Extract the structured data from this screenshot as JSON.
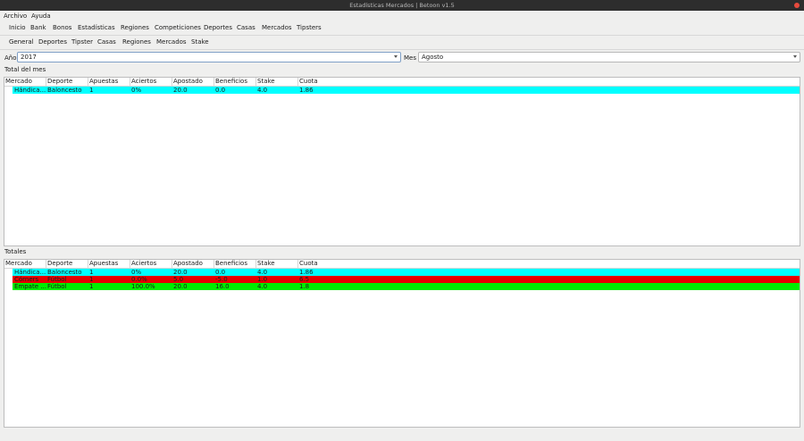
{
  "window": {
    "title": "Estadísticas Mercados | Betoon v1.5"
  },
  "menubar": {
    "items": [
      "Archivo",
      "Ayuda"
    ]
  },
  "main_toolbar": {
    "items": [
      "Inicio",
      "Bank",
      "Bonos",
      "Estadísticas",
      "Regiones",
      "Competiciones",
      "Deportes",
      "Casas",
      "Mercados",
      "Tipsters"
    ]
  },
  "sub_toolbar": {
    "items": [
      "General",
      "Deportes",
      "Tipster",
      "Casas",
      "Regiones",
      "Mercados",
      "Stake"
    ]
  },
  "filters": {
    "year_label": "Año",
    "year_value": "2017",
    "month_label": "Mes",
    "month_value": "Agosto"
  },
  "columns": [
    "Mercado",
    "Deporte",
    "Apuestas",
    "Aciertos",
    "Apostado",
    "Beneficios",
    "Stake",
    "Cuota"
  ],
  "month_table": {
    "label": "Total del mes",
    "rows": [
      {
        "color": "#00ffff",
        "cells": [
          "Hándica...",
          "Baloncesto",
          "1",
          "0%",
          "20.0",
          "0.0",
          "4.0",
          "1.86"
        ]
      }
    ]
  },
  "totals_table": {
    "label": "Totales",
    "rows": [
      {
        "color": "#00ffff",
        "cells": [
          "Hándica...",
          "Baloncesto",
          "1",
          "0%",
          "20.0",
          "0.0",
          "4.0",
          "1.86"
        ]
      },
      {
        "color": "#e60000",
        "cells": [
          "Córners",
          "Fútbol",
          "1",
          "0.0%",
          "5.0",
          "-5.0",
          "1.0",
          "6.5"
        ]
      },
      {
        "color": "#00ee00",
        "cells": [
          "Empate ...",
          "Fútbol",
          "1",
          "100.0%",
          "20.0",
          "16.0",
          "4.0",
          "1.8"
        ]
      }
    ]
  }
}
